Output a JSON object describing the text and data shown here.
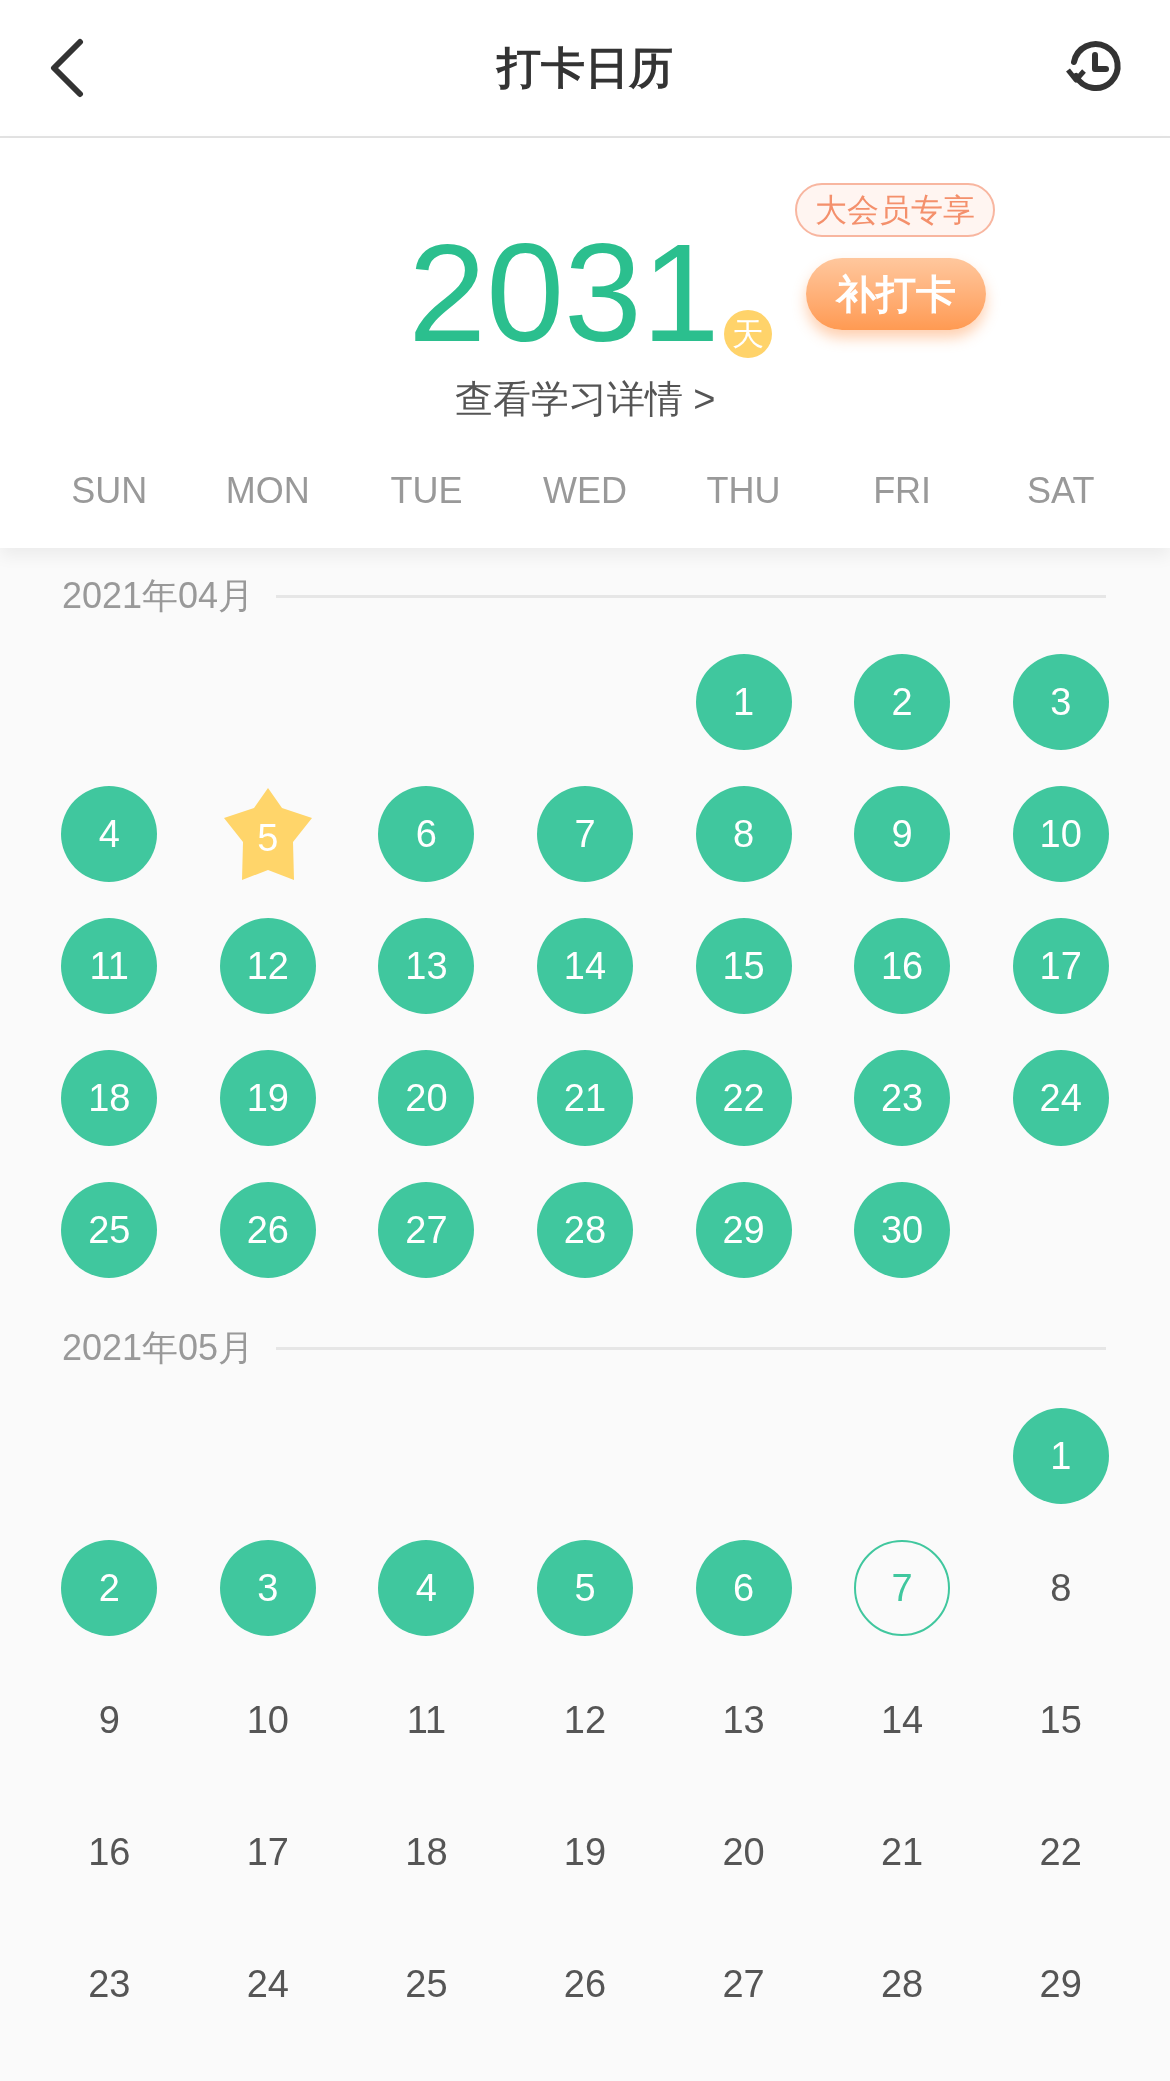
{
  "header": {
    "title": "打卡日历"
  },
  "summary": {
    "count": "2031",
    "unit": "天",
    "badge": "大会员专享",
    "makeup_button": "补打卡",
    "details_link": "查看学习详情 >"
  },
  "weekdays": [
    "SUN",
    "MON",
    "TUE",
    "WED",
    "THU",
    "FRI",
    "SAT"
  ],
  "months": [
    {
      "label": "2021年04月",
      "weeks": [
        [
          {
            "kind": "blank"
          },
          {
            "kind": "blank"
          },
          {
            "kind": "blank"
          },
          {
            "kind": "blank"
          },
          {
            "day": "1",
            "kind": "done"
          },
          {
            "day": "2",
            "kind": "done"
          },
          {
            "day": "3",
            "kind": "done"
          }
        ],
        [
          {
            "day": "4",
            "kind": "done"
          },
          {
            "day": "5",
            "kind": "star"
          },
          {
            "day": "6",
            "kind": "done"
          },
          {
            "day": "7",
            "kind": "done"
          },
          {
            "day": "8",
            "kind": "done"
          },
          {
            "day": "9",
            "kind": "done"
          },
          {
            "day": "10",
            "kind": "done"
          }
        ],
        [
          {
            "day": "11",
            "kind": "done"
          },
          {
            "day": "12",
            "kind": "done"
          },
          {
            "day": "13",
            "kind": "done"
          },
          {
            "day": "14",
            "kind": "done"
          },
          {
            "day": "15",
            "kind": "done"
          },
          {
            "day": "16",
            "kind": "done"
          },
          {
            "day": "17",
            "kind": "done"
          }
        ],
        [
          {
            "day": "18",
            "kind": "done"
          },
          {
            "day": "19",
            "kind": "done"
          },
          {
            "day": "20",
            "kind": "done"
          },
          {
            "day": "21",
            "kind": "done"
          },
          {
            "day": "22",
            "kind": "done"
          },
          {
            "day": "23",
            "kind": "done"
          },
          {
            "day": "24",
            "kind": "done"
          }
        ],
        [
          {
            "day": "25",
            "kind": "done"
          },
          {
            "day": "26",
            "kind": "done"
          },
          {
            "day": "27",
            "kind": "done"
          },
          {
            "day": "28",
            "kind": "done"
          },
          {
            "day": "29",
            "kind": "done"
          },
          {
            "day": "30",
            "kind": "done"
          },
          {
            "kind": "blank"
          }
        ]
      ]
    },
    {
      "label": "2021年05月",
      "weeks": [
        [
          {
            "kind": "blank"
          },
          {
            "kind": "blank"
          },
          {
            "kind": "blank"
          },
          {
            "kind": "blank"
          },
          {
            "kind": "blank"
          },
          {
            "kind": "blank"
          },
          {
            "day": "1",
            "kind": "done"
          }
        ],
        [
          {
            "day": "2",
            "kind": "done"
          },
          {
            "day": "3",
            "kind": "done"
          },
          {
            "day": "4",
            "kind": "done"
          },
          {
            "day": "5",
            "kind": "done"
          },
          {
            "day": "6",
            "kind": "done"
          },
          {
            "day": "7",
            "kind": "today"
          },
          {
            "day": "8",
            "kind": "plain"
          }
        ],
        [
          {
            "day": "9",
            "kind": "plain"
          },
          {
            "day": "10",
            "kind": "plain"
          },
          {
            "day": "11",
            "kind": "plain"
          },
          {
            "day": "12",
            "kind": "plain"
          },
          {
            "day": "13",
            "kind": "plain"
          },
          {
            "day": "14",
            "kind": "plain"
          },
          {
            "day": "15",
            "kind": "plain"
          }
        ],
        [
          {
            "day": "16",
            "kind": "plain"
          },
          {
            "day": "17",
            "kind": "plain"
          },
          {
            "day": "18",
            "kind": "plain"
          },
          {
            "day": "19",
            "kind": "plain"
          },
          {
            "day": "20",
            "kind": "plain"
          },
          {
            "day": "21",
            "kind": "plain"
          },
          {
            "day": "22",
            "kind": "plain"
          }
        ],
        [
          {
            "day": "23",
            "kind": "plain"
          },
          {
            "day": "24",
            "kind": "plain"
          },
          {
            "day": "25",
            "kind": "plain"
          },
          {
            "day": "26",
            "kind": "plain"
          },
          {
            "day": "27",
            "kind": "plain"
          },
          {
            "day": "28",
            "kind": "plain"
          },
          {
            "day": "29",
            "kind": "plain"
          }
        ]
      ]
    }
  ]
}
